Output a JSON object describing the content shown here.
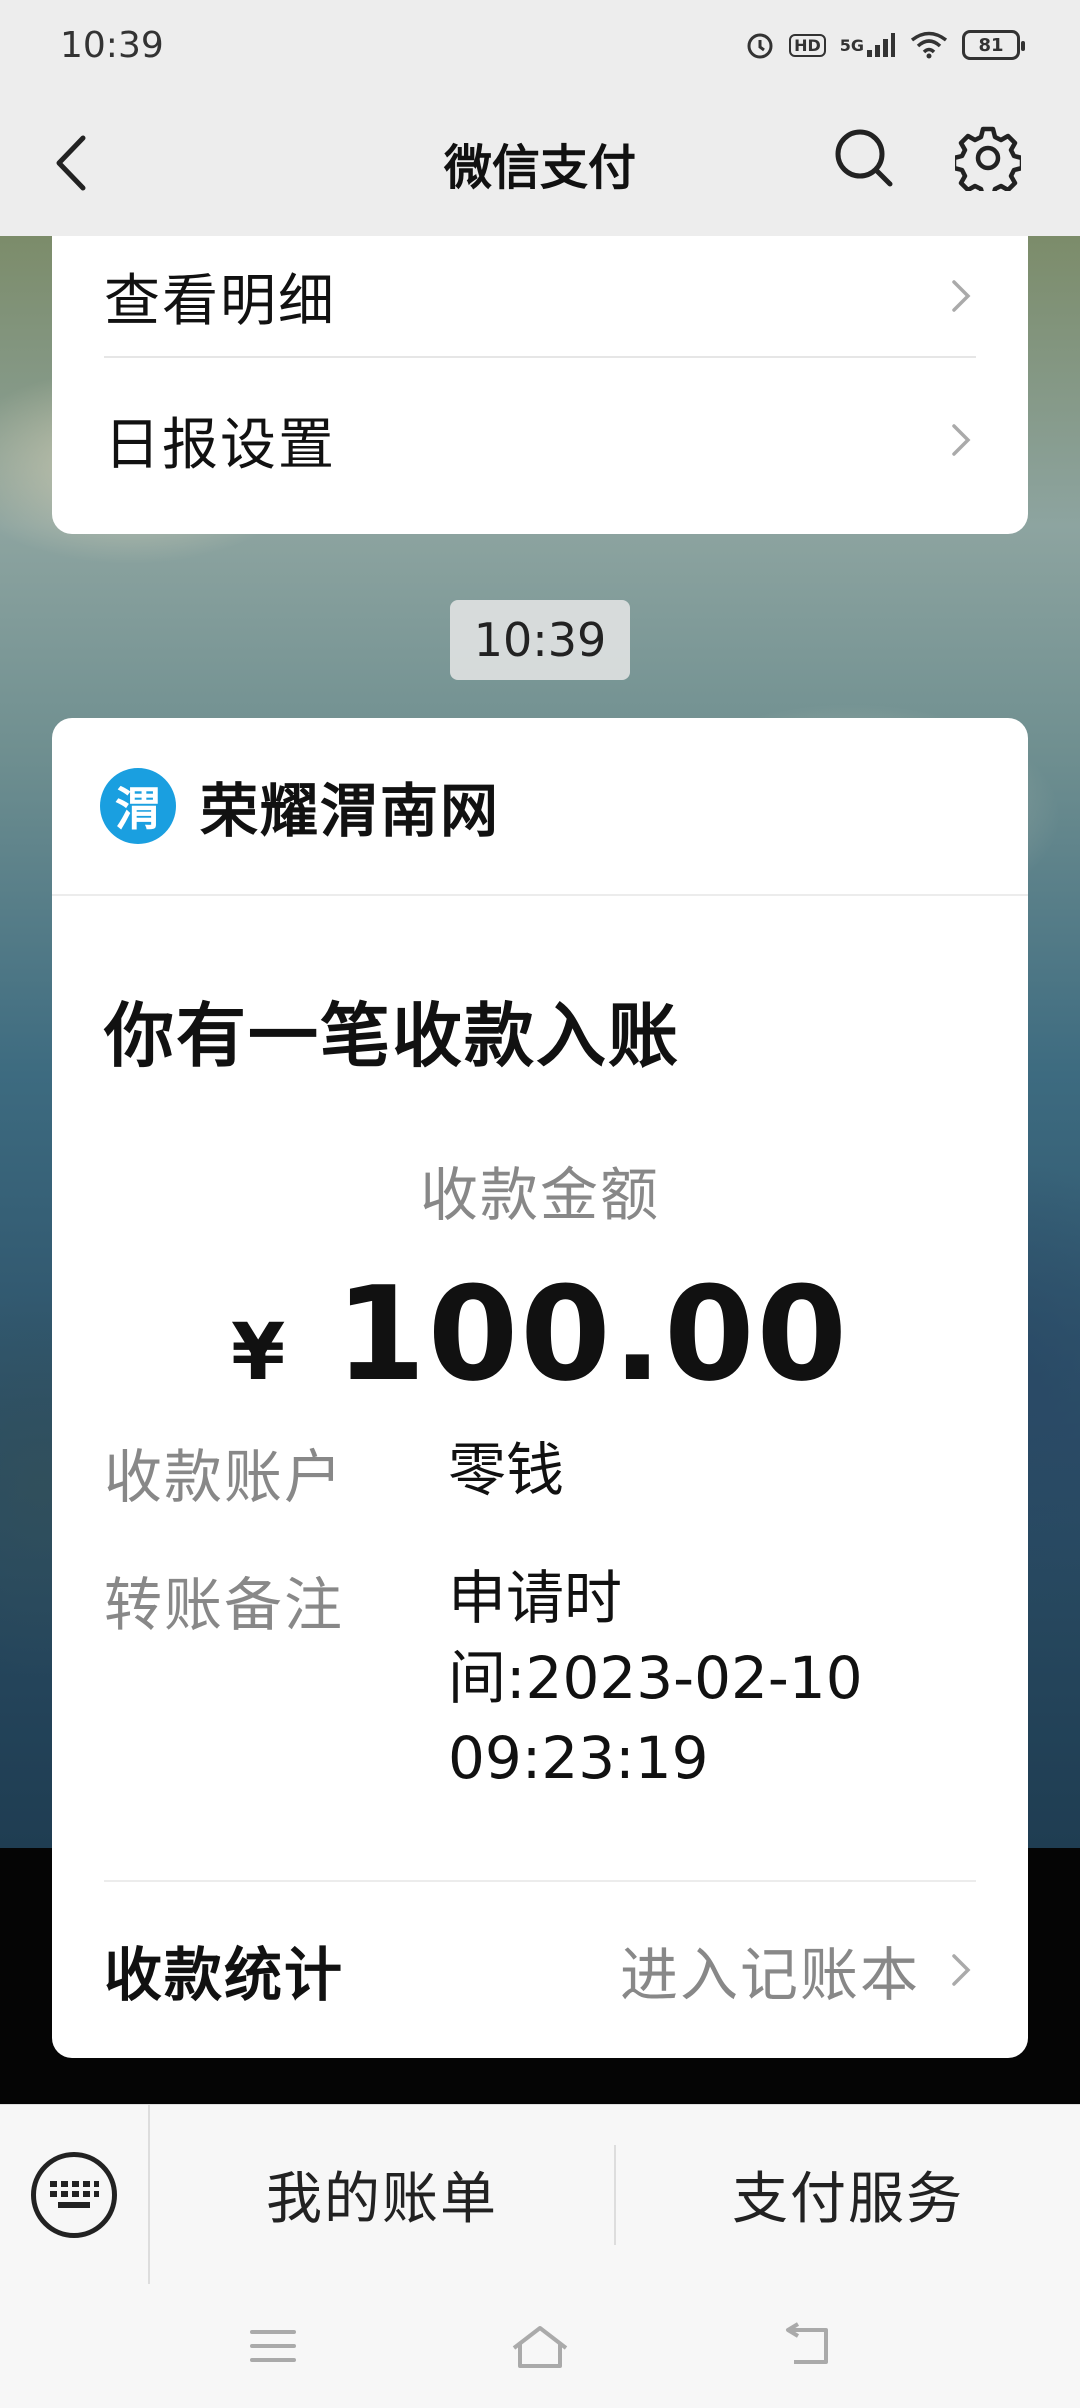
{
  "status_bar": {
    "time": "10:39",
    "network": "5G",
    "hd": "HD",
    "battery": "81"
  },
  "header": {
    "title": "微信支付"
  },
  "top_card": {
    "details_label": "查看明细",
    "report_label": "日报设置"
  },
  "timestamp_chip": "10:39",
  "notification": {
    "org_logo_char": "渭",
    "org_name": "荣耀渭南网",
    "title": "你有一笔收款入账",
    "amount_label": "收款金额",
    "currency": "¥",
    "amount": "100.00",
    "account_label": "收款账户",
    "account_value": "零钱",
    "remark_label": "转账备注",
    "remark_value_line1": "申请时",
    "remark_value_line2": "间:2023-02-10",
    "remark_value_line3": "09:23:19",
    "stats_label": "收款统计",
    "stats_link": "进入记账本"
  },
  "bottom_menu": {
    "bill_label": "我的账单",
    "service_label": "支付服务"
  },
  "colors": {
    "header_bg": "#ededed",
    "card_bg": "#ffffff",
    "muted_text": "#888888",
    "logo_blue": "#1a9fe0"
  }
}
